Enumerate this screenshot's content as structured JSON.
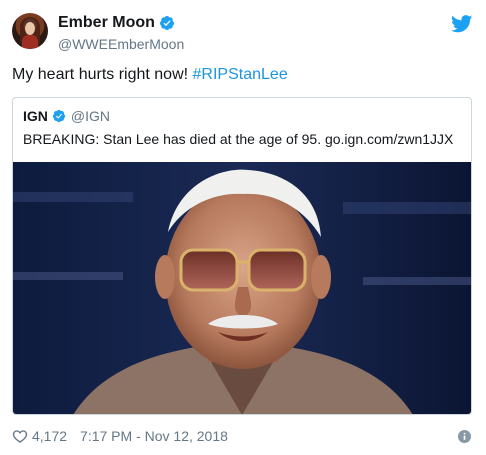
{
  "user": {
    "display_name": "Ember Moon",
    "handle": "@WWEEmberMoon",
    "avatar_icon": "avatar-photo",
    "verified": true
  },
  "tweet": {
    "text": "My heart hurts right now!",
    "hashtag": "#RIPStanLee"
  },
  "quoted_tweet": {
    "display_name": "IGN",
    "handle": "@IGN",
    "verified": true,
    "text": "BREAKING: Stan Lee has died at the age of 95. go.ign.com/zwn1JJX",
    "image_icon": "stan-lee-portrait-photo"
  },
  "footer": {
    "likes": "4,172",
    "timestamp": "7:17 PM - Nov 12, 2018"
  },
  "colors": {
    "brand": "#1da1f2",
    "hashtag": "#1b95e0",
    "secondary_text": "#657786",
    "border": "#ccd6dd"
  }
}
